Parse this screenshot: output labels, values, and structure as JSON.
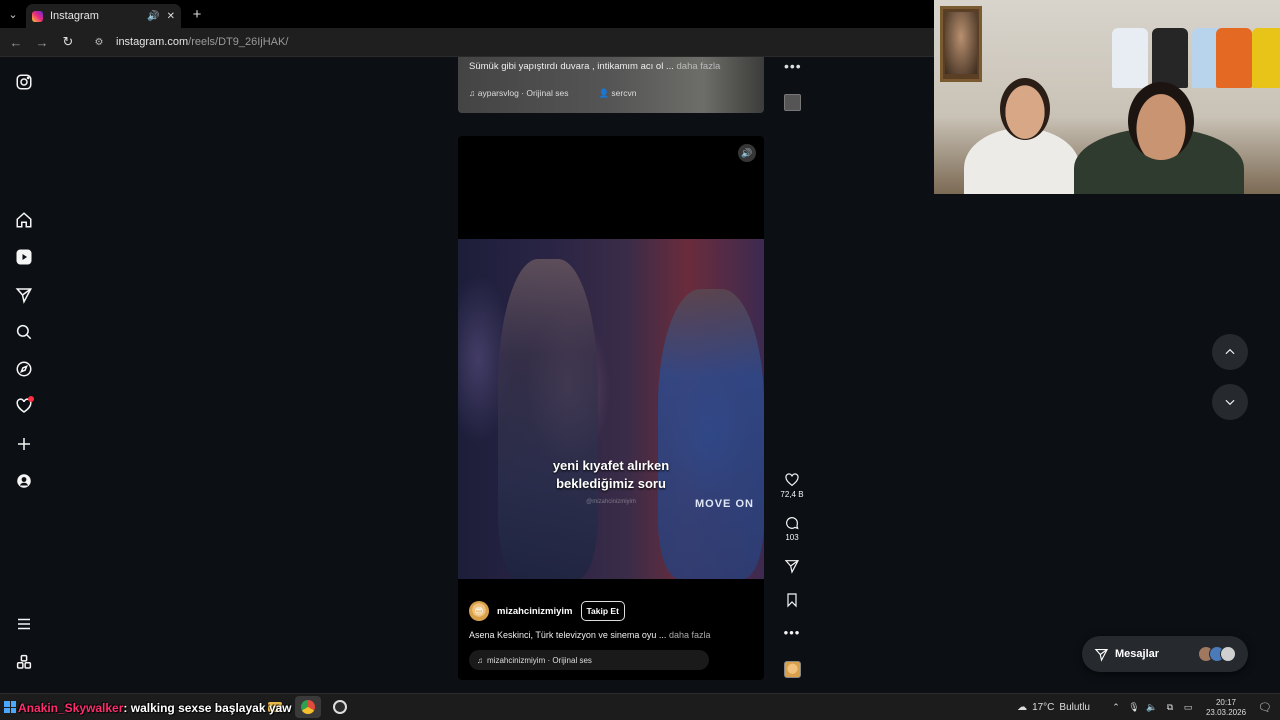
{
  "browser": {
    "tab_title": "Instagram",
    "url_host": "instagram.com",
    "url_path": "/reels/DT9_26IjHAK/",
    "new_tab": "+",
    "tab_audio": "🔊",
    "tab_close": "✕",
    "tab_menu": "⌄",
    "back": "←",
    "forward": "→",
    "reload": "↻",
    "site_info": "⚙"
  },
  "sidebar": {
    "items": [
      "instagram-logo",
      "home",
      "reels",
      "messages",
      "search",
      "explore",
      "notifications",
      "create",
      "profile",
      "more",
      "also-from-meta"
    ]
  },
  "prev_reel": {
    "caption": "Sümük gibi yapıştırdı duvara , intikamım acı ol ...",
    "more_label": "daha fazla",
    "audio": "ayparsvlog · Orijinal ses",
    "tagged_user": "sercvn",
    "more_dots": "•••"
  },
  "reel": {
    "overlay_text_line1": "yeni kıyafet alırken",
    "overlay_text_line2": "beklediğimiz soru",
    "watermark": "@mizahcinizmiyim",
    "hoodie_text": "MOVE ON",
    "author": "mizahcinizmiyim",
    "follow_label": "Takip Et",
    "caption": "Asena Keskinci, Türk televizyon ve sinema oyu ...",
    "more_label": "daha fazla",
    "audio": "mizahcinizmiyim · Orijinal ses",
    "volume_icon": "🔊"
  },
  "actions": {
    "likes": "72,4 B",
    "comments": "103",
    "more_dots": "•••"
  },
  "messages": {
    "label": "Mesajlar"
  },
  "colors": {
    "background": "#0c1014",
    "notification_dot": "#ff3040",
    "chat_user": "#ff2d6e"
  },
  "taskbar": {
    "chat_user": "Anakin_Skywalker",
    "chat_message": ": walking sexse başlayak yaw",
    "temperature": "17°C",
    "weather": "Bulutlu",
    "time": "20:17",
    "date": "23.03.2026"
  }
}
